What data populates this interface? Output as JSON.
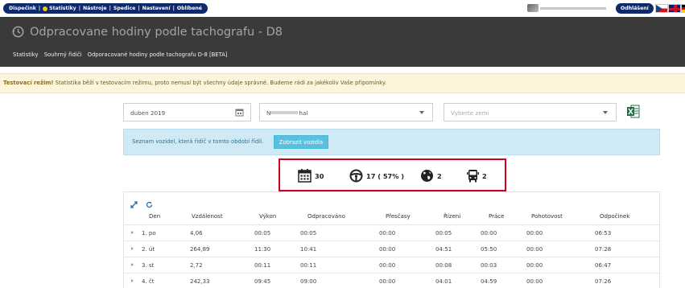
{
  "topnav": {
    "items": [
      "Dispečink",
      "Statistiky",
      "Nástroje",
      "Spedice",
      "Nastavení",
      "Oblíbené"
    ],
    "logout": "Odhlášení"
  },
  "header": {
    "title": "Odpracovane hodiny podle tachografu - D8",
    "breadcrumbs": [
      "Statistiky",
      "Souhrný řidiči",
      "Odporacované hodiny podle tachografu D-8 [BETA]"
    ]
  },
  "warning": {
    "strong": "Testovací režim!",
    "text": " Statistika běží v testovacím režimu, proto nemusí být všechny údaje správné. Budeme rádi za jakékoliv Vaše připomínky."
  },
  "filters": {
    "date_value": "duben 2019",
    "driver_prefix": "N",
    "driver_suffix": "hal",
    "country_placeholder": "Vyberte zemi"
  },
  "info": {
    "text": "Seznam vozidel, která řidič v tomto období řídil.",
    "button": "Zobrazit vozidla"
  },
  "stats": {
    "days": "30",
    "driving": "17 ( 57% )",
    "countries": "2",
    "vehicles": "2"
  },
  "table": {
    "headers": [
      "Den",
      "Vzdálenost",
      "Výkon",
      "Odpracováno",
      "Přesčasy",
      "Řízení",
      "Práce",
      "Pohotovost",
      "Odpočinek"
    ],
    "rows": [
      [
        "1. po",
        "4,06",
        "00:05",
        "00:05",
        "00:00",
        "00:05",
        "00:00",
        "00:00",
        "06:53"
      ],
      [
        "2. út",
        "264,89",
        "11:30",
        "10:41",
        "00:00",
        "04:51",
        "05:50",
        "00:00",
        "07:28"
      ],
      [
        "3. st",
        "2,72",
        "00:11",
        "00:11",
        "00:00",
        "00:08",
        "00:03",
        "00:00",
        "06:47"
      ],
      [
        "4. čt",
        "242,33",
        "09:45",
        "09:00",
        "00:00",
        "04:01",
        "04:59",
        "00:00",
        "07:26"
      ]
    ]
  },
  "colors": {
    "nav": "#0e2a6e",
    "header_bg": "#3a3a3a",
    "highlight": "#d0021b",
    "info_bg": "#cfe9f5",
    "info_button": "#5bc0de"
  }
}
